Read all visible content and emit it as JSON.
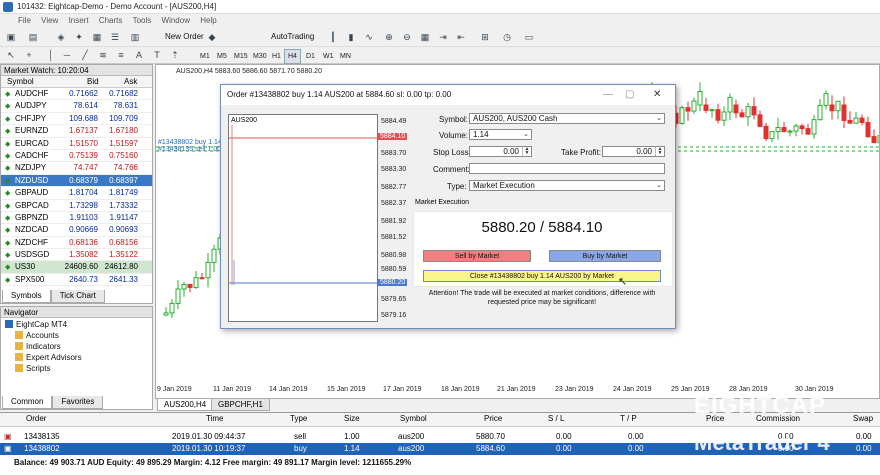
{
  "window": {
    "title": "101432: Eightcap-Demo - Demo Account - [AUS200,H4]"
  },
  "menu": [
    "File",
    "View",
    "Insert",
    "Charts",
    "Tools",
    "Window",
    "Help"
  ],
  "toolbar": {
    "new_order": "New Order",
    "autotrading": "AutoTrading"
  },
  "timeframes": [
    "M1",
    "M5",
    "M15",
    "M30",
    "H1",
    "H4",
    "D1",
    "W1",
    "MN"
  ],
  "timeframe_selected": "H4",
  "market_watch": {
    "title": "Market Watch: 10:20:04",
    "col_symbol": "Symbol",
    "col_bid": "Bid",
    "col_ask": "Ask",
    "rows": [
      {
        "symbol": "AUDCHF",
        "bid": "0.71662",
        "ask": "0.71682",
        "dir": "up"
      },
      {
        "symbol": "AUDJPY",
        "bid": "78.614",
        "ask": "78.631",
        "dir": "up"
      },
      {
        "symbol": "CHFJPY",
        "bid": "109.688",
        "ask": "109.709",
        "dir": "up"
      },
      {
        "symbol": "EURNZD",
        "bid": "1.67137",
        "ask": "1.67180",
        "dir": "dn"
      },
      {
        "symbol": "EURCAD",
        "bid": "1.51570",
        "ask": "1.51597",
        "dir": "dn"
      },
      {
        "symbol": "CADCHF",
        "bid": "0.75139",
        "ask": "0.75160",
        "dir": "dn"
      },
      {
        "symbol": "NZDJPY",
        "bid": "74.747",
        "ask": "74.766",
        "dir": "dn"
      },
      {
        "symbol": "NZDUSD",
        "bid": "0.68379",
        "ask": "0.68397",
        "dir": "hl"
      },
      {
        "symbol": "GBPAUD",
        "bid": "1.81704",
        "ask": "1.81749",
        "dir": "up"
      },
      {
        "symbol": "GBPCAD",
        "bid": "1.73298",
        "ask": "1.73332",
        "dir": "up"
      },
      {
        "symbol": "GBPNZD",
        "bid": "1.91103",
        "ask": "1.91147",
        "dir": "up"
      },
      {
        "symbol": "NZDCAD",
        "bid": "0.90669",
        "ask": "0.90693",
        "dir": "up"
      },
      {
        "symbol": "NZDCHF",
        "bid": "0.68136",
        "ask": "0.68156",
        "dir": "dn"
      },
      {
        "symbol": "USDSGD",
        "bid": "1.35082",
        "ask": "1.35122",
        "dir": "dn"
      },
      {
        "symbol": "US30",
        "bid": "24609.60",
        "ask": "24612.80",
        "dir": "hl2"
      },
      {
        "symbol": "SPX500",
        "bid": "2640.73",
        "ask": "2641.33",
        "dir": "up"
      }
    ],
    "tabs": [
      "Symbols",
      "Tick Chart"
    ]
  },
  "navigator": {
    "title": "Navigator",
    "items": [
      "EightCap MT4",
      "Accounts",
      "Indicators",
      "Expert Advisors",
      "Scripts"
    ],
    "tabs": [
      "Common",
      "Favorites"
    ]
  },
  "chart": {
    "header": "AUS200,H4  5883.60 5886.60 5871.70 5880.20",
    "order_labels": [
      "#13438802 buy 1.14",
      "#13438135 sell 1.00"
    ],
    "dates": [
      "9 Jan 2019",
      "11 Jan 2019",
      "14 Jan 2019",
      "15 Jan 2019",
      "17 Jan 2019",
      "18 Jan 2019",
      "21 Jan 2019",
      "23 Jan 2019",
      "24 Jan 2019",
      "25 Jan 2019",
      "28 Jan 2019",
      "30 Jan 2019"
    ],
    "tabs": [
      "AUS200,H4",
      "GBPCHF,H1"
    ]
  },
  "dialog": {
    "title": "Order #13438802 buy 1.14 AUS200 at 5884.60 sl: 0.00 tp: 0.00",
    "mini_chart_symbol": "AUS200",
    "price_axis": [
      "5884.49",
      "5884.10",
      "5883.70",
      "5883.30",
      "5882.77",
      "5882.37",
      "5881.92",
      "5881.52",
      "5880.98",
      "5880.59",
      "5880.20",
      "5879.65",
      "5879.16"
    ],
    "symbol_label": "Symbol:",
    "symbol_value": "AUS200, AUS200 Cash",
    "volume_label": "Volume:",
    "volume_value": "1.14",
    "sl_label": "Stop Loss:",
    "sl_value": "0.00",
    "tp_label": "Take Profit:",
    "tp_value": "0.00",
    "comment_label": "Comment:",
    "comment_value": "",
    "type_label": "Type:",
    "type_value": "Market Execution",
    "section": "Market Execution",
    "quote": "5880.20 / 5884.10",
    "sell_btn": "Sell by Market",
    "buy_btn": "Buy by Market",
    "close_btn": "Close #13438802 buy 1.14 AUS200 by Market",
    "warning": "Attention! The trade will be executed at market conditions, difference with requested price may be significant!"
  },
  "terminal": {
    "headers": [
      "Order",
      "Time",
      "Type",
      "Size",
      "Symbol",
      "Price",
      "S / L",
      "T / P",
      "Price",
      "Commission",
      "Swap"
    ],
    "rows": [
      {
        "order": "13438135",
        "time": "2019.01.30 09:44:37",
        "type": "sell",
        "size": "1.00",
        "symbol": "aus200",
        "price": "5880.70",
        "sl": "0.00",
        "tp": "0.00",
        "cur": "",
        "commission": "0.00",
        "swap": "0.00"
      },
      {
        "order": "13438802",
        "time": "2019.01.30 10:19:37",
        "type": "buy",
        "size": "1.14",
        "symbol": "aus200",
        "price": "5884.60",
        "sl": "0.00",
        "tp": "0.00",
        "cur": "",
        "commission": "0.00",
        "swap": "0.00"
      }
    ],
    "balance": "Balance: 49 903.71 AUD  Equity: 49 895.29  Margin: 4.12  Free margin: 49 891.17  Margin level: 1211655.29%"
  },
  "watermark": {
    "brand": "EIGHTCAP",
    "product": "MetaTrader 4"
  }
}
